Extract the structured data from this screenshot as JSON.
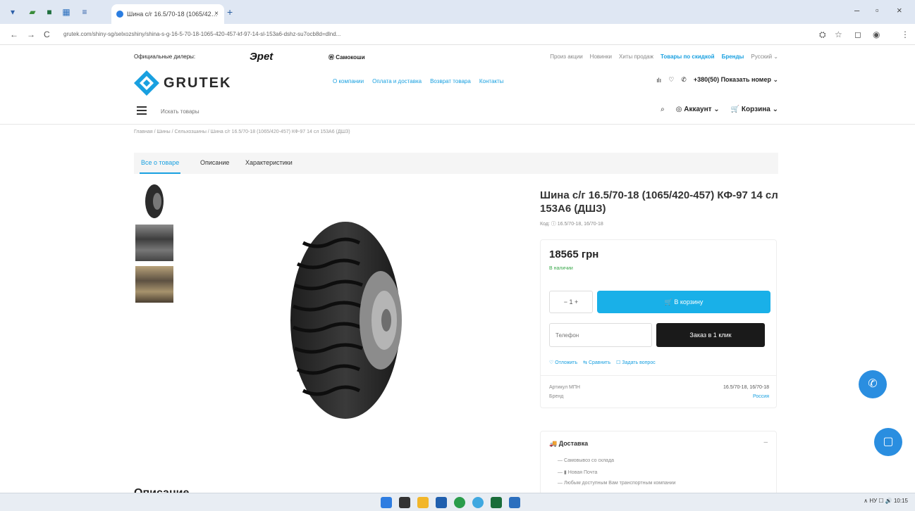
{
  "browser": {
    "tab_title": "Шина с/г 16.5/70-18 (1065/42…",
    "tab_close": "×",
    "new_tab": "+",
    "url": "grutek.com/shiny-sg/selxozshiny/shina-s-g-16-5-70-18-1065-420-457-kf-97-14-sl-153a6-dshz-su7ocb8d=dlnd...",
    "nav_back": "←",
    "nav_forward": "→",
    "nav_reload": "C"
  },
  "site": {
    "top_label": "Официальные дилеры:",
    "brand1": "Эpet",
    "brand2": "Ⓦ Самокоши",
    "top_links": [
      "Произ акции",
      "Новинки",
      "Хиты продаж",
      "Товары по скидкой",
      "Бренды",
      "Русский ⌄"
    ],
    "logo_text": "GRUTEK",
    "menu": [
      "О компании",
      "Оплата и доставка",
      "Возврат товара",
      "Контакты"
    ],
    "phone": "+380(50) Показать номер ⌄",
    "search_placeholder": "Искать товары",
    "account": "Аккаунт ⌄",
    "cart": "Корзина ⌄",
    "breadcrumbs": "Главная / Шины / Сельхозшины / Шина с/г 16.5/70-18 (1065/420-457) КФ-97 14 сл 153А6 (ДШЗ)"
  },
  "product": {
    "tabs": [
      "Все о товаре",
      "Описание",
      "Характеристики"
    ],
    "title": "Шина с/г 16.5/70-18 (1065/420-457) КФ-97 14 сл 153А6 (ДШЗ)",
    "code": "Код: ⓘ 16.5/70-18, 16/70-18",
    "price": "18565 грн",
    "stock": "В наличии",
    "qty": "− 1 +",
    "buy_label": "В корзину",
    "phone_placeholder": "Телефон",
    "call_label": "Заказ в 1 клик",
    "actions": [
      "♡ Отложить",
      "⇆ Сравнить",
      "☐ Задать вопрос"
    ],
    "attributes": [
      {
        "label": "Артикул МПН",
        "value": "16.5/70-18, 16/70-18"
      },
      {
        "label": "Бренд",
        "value": "Россия"
      }
    ],
    "delivery_title": "Доставка",
    "delivery_items": [
      "— Самовывоз со склада",
      "— ▮ Новая Почта",
      "— Любым доступным Вам транспортным компании"
    ],
    "description_heading": "Описание"
  },
  "taskbar": {
    "tray": "∧  НУ  ☐ 🔊  10:15"
  },
  "colors": {
    "accent": "#19b0e8",
    "dark_button": "#1a1a1a",
    "fab": "#2a8ee0"
  }
}
